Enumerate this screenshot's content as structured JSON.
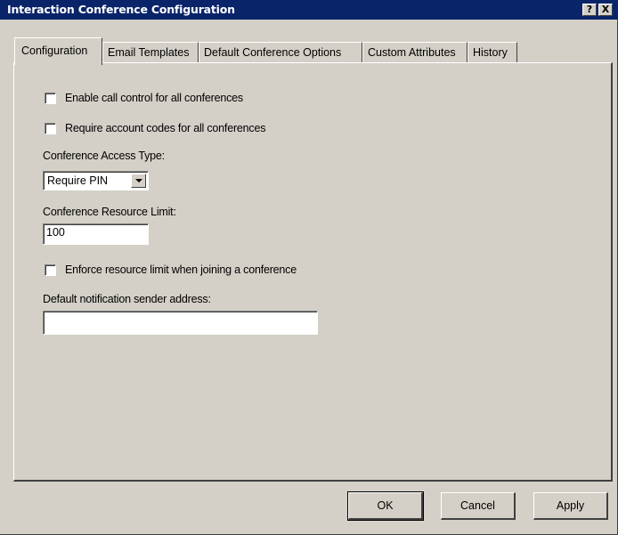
{
  "window": {
    "title": "Interaction Conference Configuration",
    "help_label": "?",
    "close_label": "X"
  },
  "tabs": [
    {
      "label": "Configuration",
      "active": true
    },
    {
      "label": "Email Templates",
      "active": false
    },
    {
      "label": "Default Conference Options",
      "active": false
    },
    {
      "label": "Custom Attributes",
      "active": false
    },
    {
      "label": "History",
      "active": false
    }
  ],
  "form": {
    "enable_call_control": {
      "label": "Enable call control for all conferences",
      "checked": false
    },
    "require_account_codes": {
      "label": "Require account codes for all conferences",
      "checked": false
    },
    "access_type": {
      "label": "Conference Access Type:",
      "value": "Require PIN"
    },
    "resource_limit": {
      "label": "Conference Resource Limit:",
      "value": "100"
    },
    "enforce_limit": {
      "label": "Enforce resource limit when joining a conference",
      "checked": false
    },
    "sender_address": {
      "label": "Default notification sender address:",
      "value": ""
    }
  },
  "buttons": {
    "ok": "OK",
    "cancel": "Cancel",
    "apply": "Apply"
  },
  "colors": {
    "titlebar": "#0a246a",
    "face": "#d4d0c8"
  }
}
